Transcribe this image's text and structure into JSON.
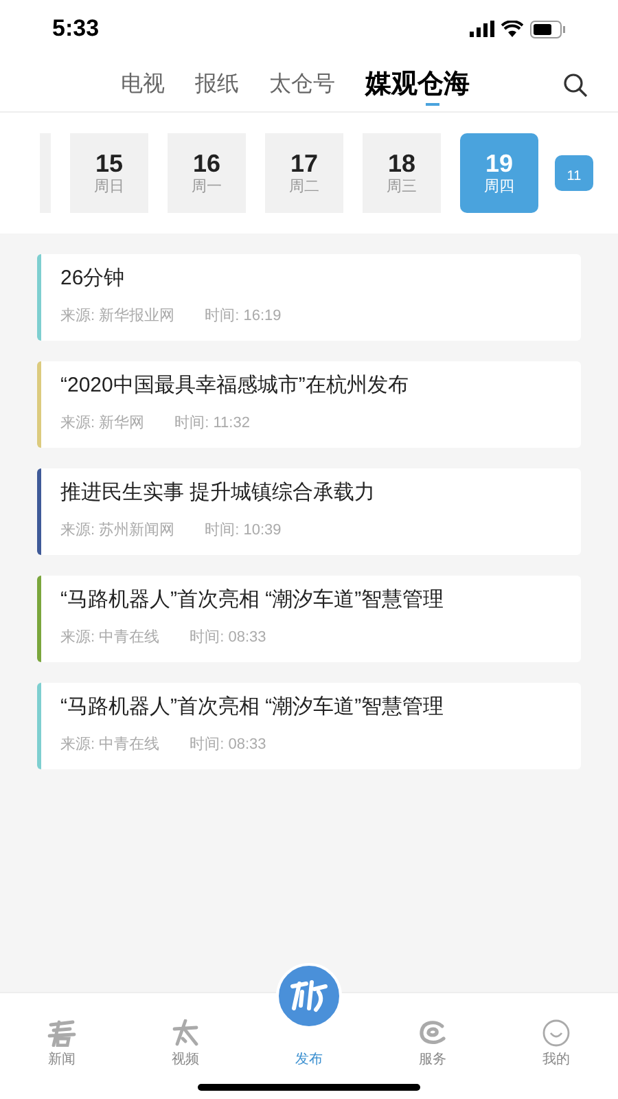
{
  "status_bar": {
    "time": "5:33"
  },
  "tabs": [
    {
      "label": "电视",
      "selected": false
    },
    {
      "label": "报纸",
      "selected": false
    },
    {
      "label": "太仓号",
      "selected": false
    },
    {
      "label": "媒观仓海",
      "selected": true
    }
  ],
  "dates": [
    {
      "day": "15",
      "weekday": "周日",
      "selected": false
    },
    {
      "day": "16",
      "weekday": "周一",
      "selected": false
    },
    {
      "day": "17",
      "weekday": "周二",
      "selected": false
    },
    {
      "day": "18",
      "weekday": "周三",
      "selected": false
    },
    {
      "day": "19",
      "weekday": "周四",
      "selected": true
    }
  ],
  "calendar_button": {
    "label": "11"
  },
  "articles": [
    {
      "title": "26分钟",
      "source": "来源: 新华报业网",
      "time": "时间: 16:19",
      "color": "#7ecfd0"
    },
    {
      "title": "“2020中国最具幸福感城市”在杭州发布",
      "source": "来源: 新华网",
      "time": "时间: 11:32",
      "color": "#dccb7e"
    },
    {
      "title": "推进民生实事 提升城镇综合承载力",
      "source": "来源: 苏州新闻网",
      "time": "时间: 10:39",
      "color": "#3f5a98"
    },
    {
      "title": "“马路机器人”首次亮相 “潮汐车道”智慧管理",
      "source": "来源: 中青在线",
      "time": "时间: 08:33",
      "color": "#7aa63c"
    },
    {
      "title": "“马路机器人”首次亮相 “潮汐车道”智慧管理",
      "source": "来源: 中青在线",
      "time": "时间: 08:33",
      "color": "#7ecfd0"
    }
  ],
  "bottom_nav": [
    {
      "label": "新闻",
      "kind": "plain",
      "selected": false
    },
    {
      "label": "视频",
      "kind": "plain",
      "selected": false
    },
    {
      "label": "发布",
      "kind": "center",
      "selected": true
    },
    {
      "label": "服务",
      "kind": "plain",
      "selected": false
    },
    {
      "label": "我的",
      "kind": "plain",
      "selected": false
    }
  ]
}
